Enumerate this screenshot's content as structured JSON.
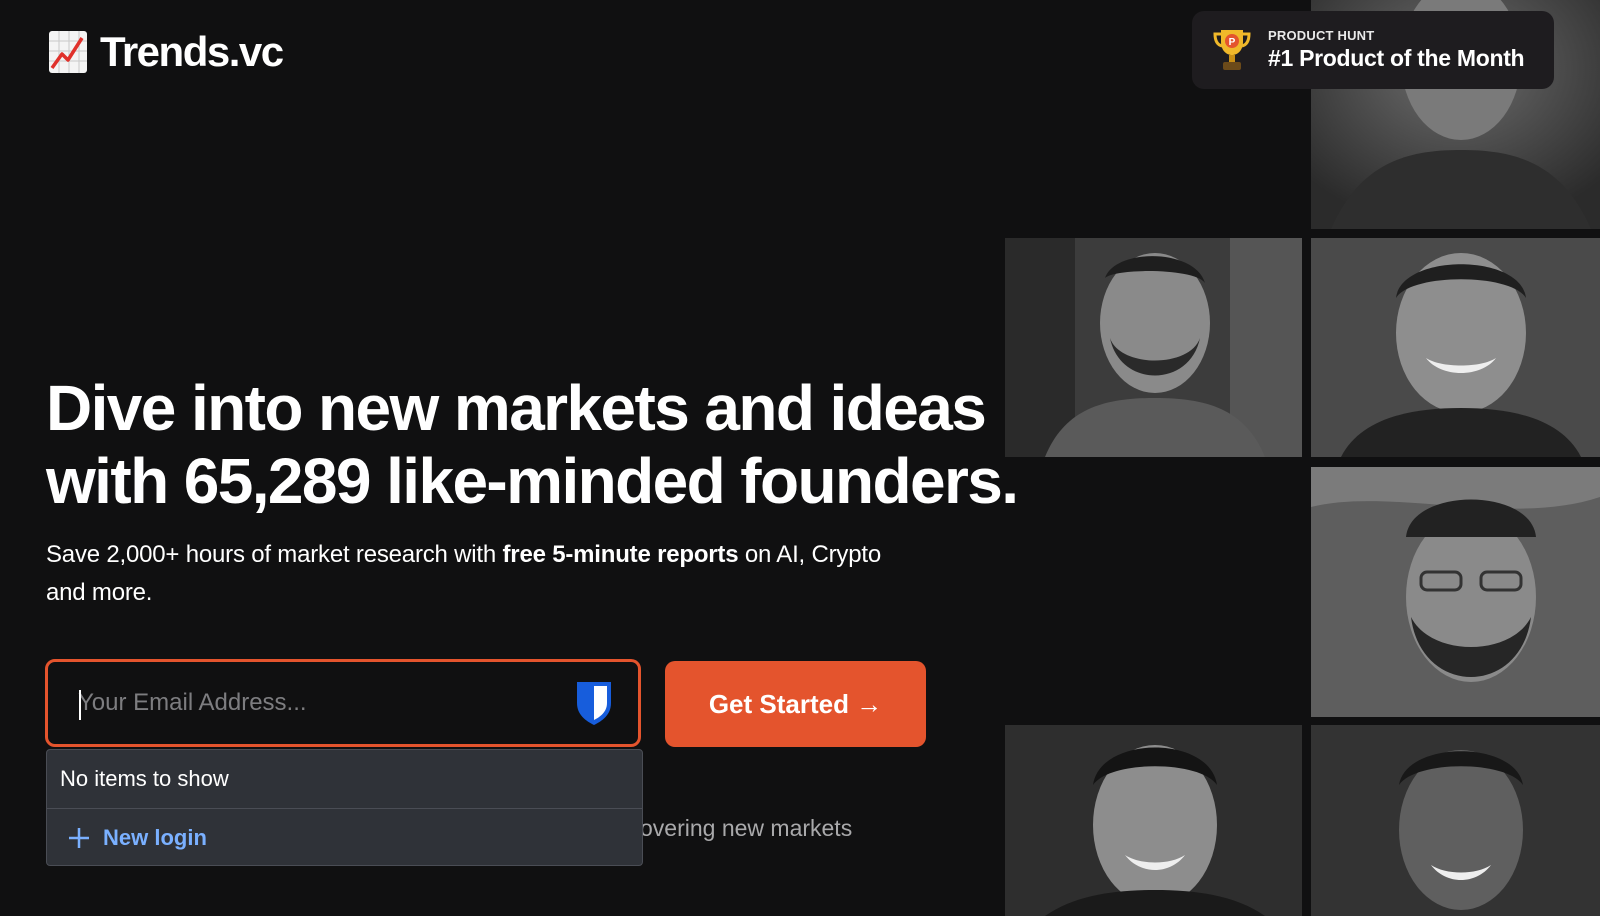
{
  "brand": {
    "name": "Trends.vc",
    "icon": "chart-increasing-icon"
  },
  "badge": {
    "kicker": "PRODUCT HUNT",
    "title": "#1 Product of the Month",
    "icon": "trophy-icon"
  },
  "hero": {
    "headline_line1": "Dive into new markets and ideas",
    "headline_line2": "with 65,289 like-minded founders.",
    "subhead_pre": "Save 2,000+ hours of market research with ",
    "subhead_bold": "free 5-minute reports",
    "subhead_post": " on AI, Crypto and more."
  },
  "signup": {
    "email_placeholder": "Your Email Address...",
    "email_value": "",
    "cta_label": "Get Started →"
  },
  "social_proof": {
    "text": "overing new markets"
  },
  "autofill": {
    "empty_text": "No items to show",
    "new_login_label": "New login",
    "icon": "bitwarden-shield-icon"
  },
  "colors": {
    "background": "#101011",
    "accent": "#e4542d",
    "link_blue": "#7ab0ff",
    "dropdown_bg": "#2f3238"
  }
}
